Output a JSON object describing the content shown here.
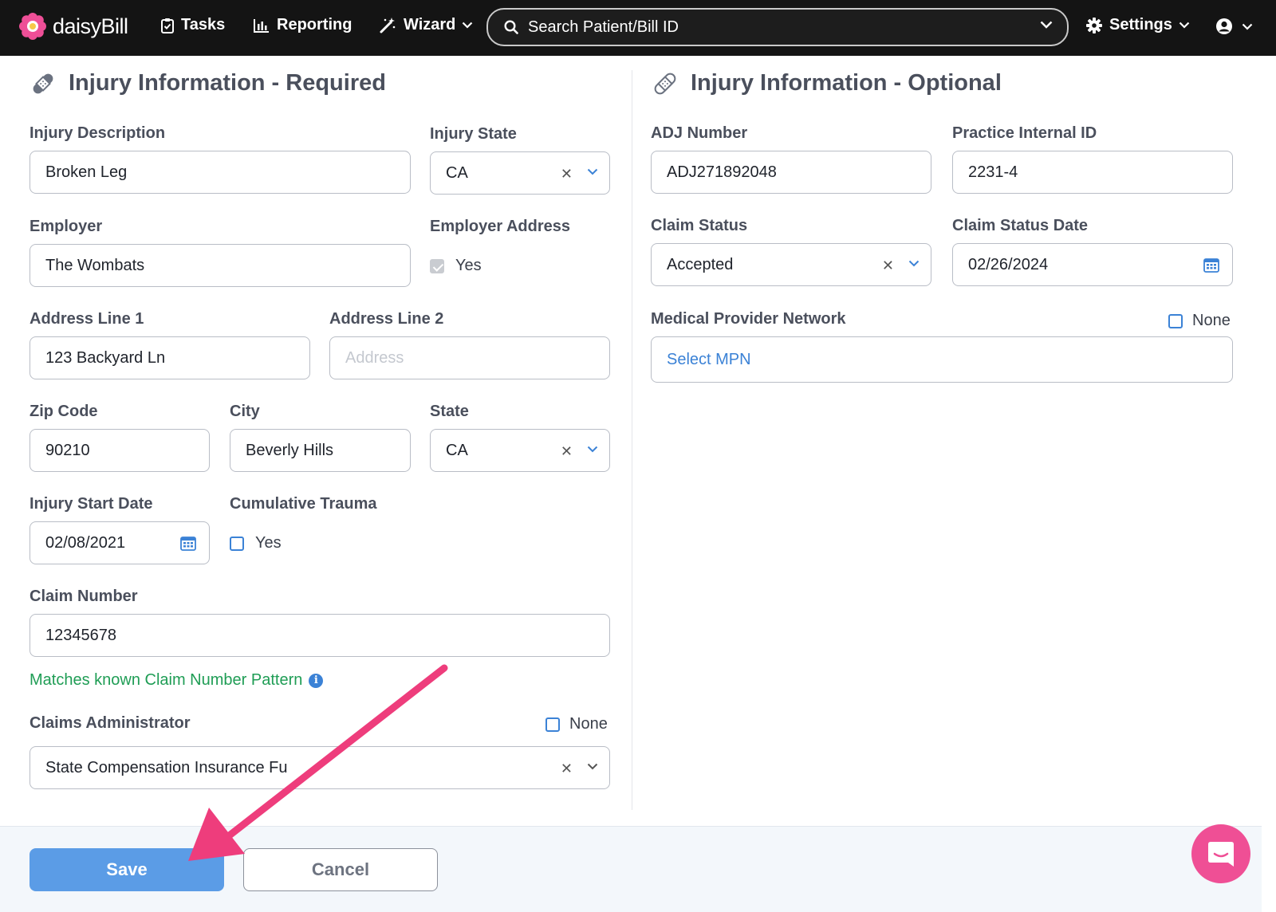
{
  "nav": {
    "brand": "daisyBill",
    "tasks": "Tasks",
    "reporting": "Reporting",
    "wizard": "Wizard",
    "search_placeholder": "Search Patient/Bill ID",
    "settings": "Settings"
  },
  "required": {
    "title": "Injury Information - Required",
    "injury_description": {
      "label": "Injury Description",
      "value": "Broken Leg"
    },
    "injury_state": {
      "label": "Injury State",
      "value": "CA"
    },
    "employer": {
      "label": "Employer",
      "value": "The Wombats"
    },
    "employer_address": {
      "label": "Employer Address",
      "option": "Yes",
      "checked": true
    },
    "address_line_1": {
      "label": "Address Line 1",
      "value": "123 Backyard Ln"
    },
    "address_line_2": {
      "label": "Address Line 2",
      "placeholder": "Address"
    },
    "zip": {
      "label": "Zip Code",
      "value": "90210"
    },
    "city": {
      "label": "City",
      "value": "Beverly Hills"
    },
    "state": {
      "label": "State",
      "value": "CA"
    },
    "injury_start_date": {
      "label": "Injury Start Date",
      "value": "02/08/2021"
    },
    "cumulative_trauma": {
      "label": "Cumulative Trauma",
      "option": "Yes",
      "checked": false
    },
    "claim_number": {
      "label": "Claim Number",
      "value": "12345678"
    },
    "claim_hint": "Matches known Claim Number Pattern",
    "claims_administrator": {
      "label": "Claims Administrator",
      "none_label": "None",
      "value": "State Compensation Insurance Fu"
    }
  },
  "optional": {
    "title": "Injury Information - Optional",
    "adj_number": {
      "label": "ADJ Number",
      "value": "ADJ271892048"
    },
    "practice_internal_id": {
      "label": "Practice Internal ID",
      "value": "2231-4"
    },
    "claim_status": {
      "label": "Claim Status",
      "value": "Accepted"
    },
    "claim_status_date": {
      "label": "Claim Status Date",
      "value": "02/26/2024"
    },
    "mpn": {
      "label": "Medical Provider Network",
      "none_label": "None",
      "placeholder": "Select MPN"
    }
  },
  "footer": {
    "save": "Save",
    "cancel": "Cancel"
  },
  "colors": {
    "accent": "#5b9ce6",
    "success": "#1f9d55",
    "chat": "#ef4f95",
    "annotation_arrow": "#ee3d7c"
  }
}
